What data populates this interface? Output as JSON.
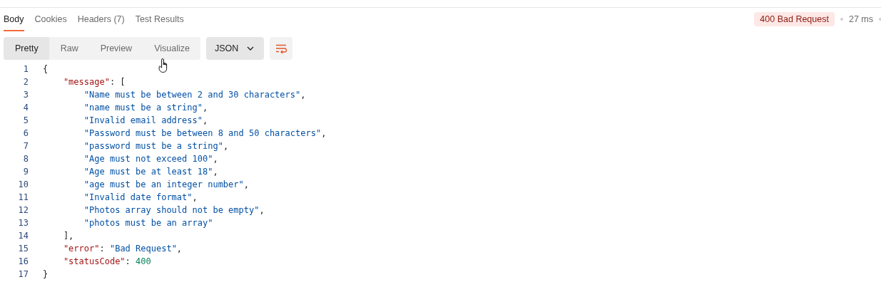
{
  "tabs": [
    {
      "label": "Body",
      "selected": true
    },
    {
      "label": "Cookies",
      "selected": false
    },
    {
      "label": "Headers (7)",
      "selected": false
    },
    {
      "label": "Test Results",
      "selected": false
    }
  ],
  "status": {
    "badge": "400 Bad Request",
    "time": "27 ms"
  },
  "view_modes": [
    {
      "label": "Pretty",
      "selected": true
    },
    {
      "label": "Raw",
      "selected": false
    },
    {
      "label": "Preview",
      "selected": false
    },
    {
      "label": "Visualize",
      "selected": false
    }
  ],
  "format_dropdown": {
    "value": "JSON"
  },
  "code_lines": [
    {
      "number": "1",
      "tokens": [
        {
          "kind": "punct",
          "text": "{"
        }
      ]
    },
    {
      "number": "2",
      "tokens": [
        {
          "kind": "key",
          "text": "    \"message\""
        },
        {
          "kind": "punct",
          "text": ": ["
        }
      ]
    },
    {
      "number": "3",
      "tokens": [
        {
          "kind": "string",
          "text": "        \"Name must be between 2 and 30 characters\""
        },
        {
          "kind": "punct",
          "text": ","
        }
      ]
    },
    {
      "number": "4",
      "tokens": [
        {
          "kind": "string",
          "text": "        \"name must be a string\""
        },
        {
          "kind": "punct",
          "text": ","
        }
      ]
    },
    {
      "number": "5",
      "tokens": [
        {
          "kind": "string",
          "text": "        \"Invalid email address\""
        },
        {
          "kind": "punct",
          "text": ","
        }
      ]
    },
    {
      "number": "6",
      "tokens": [
        {
          "kind": "string",
          "text": "        \"Password must be between 8 and 50 characters\""
        },
        {
          "kind": "punct",
          "text": ","
        }
      ]
    },
    {
      "number": "7",
      "tokens": [
        {
          "kind": "string",
          "text": "        \"password must be a string\""
        },
        {
          "kind": "punct",
          "text": ","
        }
      ]
    },
    {
      "number": "8",
      "tokens": [
        {
          "kind": "string",
          "text": "        \"Age must not exceed 100\""
        },
        {
          "kind": "punct",
          "text": ","
        }
      ]
    },
    {
      "number": "9",
      "tokens": [
        {
          "kind": "string",
          "text": "        \"Age must be at least 18\""
        },
        {
          "kind": "punct",
          "text": ","
        }
      ]
    },
    {
      "number": "10",
      "tokens": [
        {
          "kind": "string",
          "text": "        \"age must be an integer number\""
        },
        {
          "kind": "punct",
          "text": ","
        }
      ]
    },
    {
      "number": "11",
      "tokens": [
        {
          "kind": "string",
          "text": "        \"Invalid date format\""
        },
        {
          "kind": "punct",
          "text": ","
        }
      ]
    },
    {
      "number": "12",
      "tokens": [
        {
          "kind": "string",
          "text": "        \"Photos array should not be empty\""
        },
        {
          "kind": "punct",
          "text": ","
        }
      ]
    },
    {
      "number": "13",
      "tokens": [
        {
          "kind": "string",
          "text": "        \"photos must be an array\""
        }
      ]
    },
    {
      "number": "14",
      "tokens": [
        {
          "kind": "punct",
          "text": "    ],"
        }
      ]
    },
    {
      "number": "15",
      "tokens": [
        {
          "kind": "key",
          "text": "    \"error\""
        },
        {
          "kind": "punct",
          "text": ": "
        },
        {
          "kind": "string",
          "text": "\"Bad Request\""
        },
        {
          "kind": "punct",
          "text": ","
        }
      ]
    },
    {
      "number": "16",
      "tokens": [
        {
          "kind": "key",
          "text": "    \"statusCode\""
        },
        {
          "kind": "punct",
          "text": ": "
        },
        {
          "kind": "number",
          "text": "400"
        }
      ]
    },
    {
      "number": "17",
      "tokens": [
        {
          "kind": "punct",
          "text": "}"
        }
      ]
    }
  ]
}
